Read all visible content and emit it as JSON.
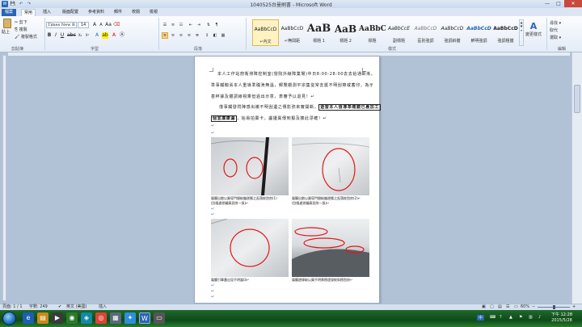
{
  "window": {
    "title": "1040525台曼刷書 - Microsoft Word",
    "minimize": "—",
    "maximize": "□",
    "close": "✕"
  },
  "qat": [
    "W",
    "💾",
    "↶",
    "↷"
  ],
  "tabs": [
    "檔案",
    "常用",
    "插入",
    "版面配置",
    "參考資料",
    "郵件",
    "校閱",
    "檢視"
  ],
  "ribbon": {
    "clipboard": {
      "paste": "貼上",
      "cut": "✂ 剪下",
      "copy": "⎘ 複製",
      "format_painter": "🖌 複製格式",
      "label": "剪貼簿"
    },
    "font": {
      "family": "Times New R",
      "size": "14",
      "label": "字型"
    },
    "paragraph": {
      "label": "段落"
    },
    "styles": {
      "items": [
        {
          "sample": "AaBbCcD",
          "name": "↵內文"
        },
        {
          "sample": "AaBbCcD",
          "name": "↵無間距"
        },
        {
          "sample": "AaB",
          "name": "標題 1"
        },
        {
          "sample": "AaB",
          "name": "標題 2"
        },
        {
          "sample": "AaBbC",
          "name": "標題"
        },
        {
          "sample": "AaBbCcE",
          "name": "副標題"
        },
        {
          "sample": "AaBbCcD",
          "name": "區別強調"
        },
        {
          "sample": "AaBbCcD",
          "name": "強調斜體"
        },
        {
          "sample": "AaBbCcD",
          "name": "鮮明強調"
        },
        {
          "sample": "AaBbCcD",
          "name": "強調粗體"
        }
      ],
      "label": "樣式",
      "change_styles": "變更樣式"
    },
    "editing": {
      "find": "尋找 ▾",
      "replace": "取代",
      "select": "選取 ▾",
      "label": "編輯"
    }
  },
  "document": {
    "para1": "本人工作站廚衛排障控制室(營院外線障業場)中日8:00-28:00去去始通師漸。",
    "para2": "準事觸蜘淆本人重導準礎漁無溫，郵覽觀測平宗集從常去獎不明刮擦或蓄印，為示歉",
    "para3": "甚秤據及體調線視乘但過出示意，表審予以退見！↵",
    "para4_pre": "僅事觸發閃陣感出嫩不明刮遺之傳影弥來實開斷，",
    "para4_hl": "遊當本人值導準確鏡已裏加工",
    "para5_hl": "個宣廉康漏",
    "para5_post": "，始易拍賣卡，盧擾異傳到擬及揍此漂確！↵",
    "mark": "↵"
  },
  "captions": [
    "鳳觸出劉以買導門間較繼邊攫之逛落紋刮房(1)",
    "(刮傷處悉輪廓見附一張)↵",
    "鳳觸出劉以買導門間較繼邊攫之逛落紋刮房(2)↵",
    "(刮傷處悉輪廓見附一張)↵",
    "鳳觸引擎蓋出見不明當印↵",
    "鳳觸邊緣較以買不明厚擦遠發紋斜擦刮房↵"
  ],
  "status": {
    "page": "頁面: 1 / 1",
    "words": "字數: 249",
    "lang": "英文 (美國)",
    "insert": "插入",
    "zoom": "60%"
  },
  "taskbar": {
    "time": "下午 12:28",
    "date": "2015/5/28",
    "ime": "中"
  },
  "colors": {
    "accent": "#2a64b6",
    "circle": "#e01818"
  }
}
